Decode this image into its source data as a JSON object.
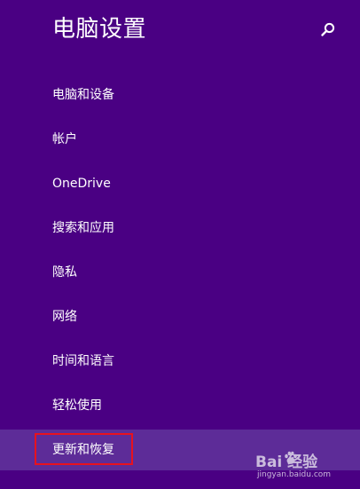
{
  "header": {
    "title": "电脑设置",
    "search_icon": "search-icon"
  },
  "nav": {
    "items": [
      {
        "label": "电脑和设备"
      },
      {
        "label": "帐户"
      },
      {
        "label": "OneDrive"
      },
      {
        "label": "搜索和应用"
      },
      {
        "label": "隐私"
      },
      {
        "label": "网络"
      },
      {
        "label": "时间和语言"
      },
      {
        "label": "轻松使用"
      },
      {
        "label": "更新和恢复",
        "selected": true
      }
    ]
  },
  "colors": {
    "background": "#4a0083",
    "selected_item": "#5d2c98",
    "highlight_border": "#e8121e",
    "text": "#ffffff"
  },
  "watermark": {
    "brand": "Bai  经验",
    "url": "jingyan.baidu.com"
  }
}
